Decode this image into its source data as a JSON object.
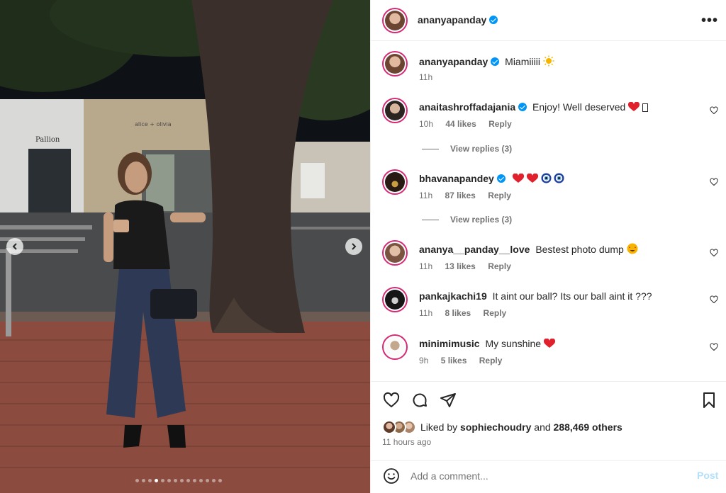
{
  "post": {
    "username": "ananyapanday",
    "caption": "Miamiiiii",
    "caption_time": "11h",
    "carousel": {
      "slides": 14,
      "active_index": 3
    }
  },
  "comments": [
    {
      "username": "anaitashroffadajania",
      "text": "Enjoy! Well deserved",
      "time": "10h",
      "likes": "44 likes",
      "reply": "Reply",
      "view_replies": "View replies (3)"
    },
    {
      "username": "bhavanapandey",
      "text": "",
      "time": "11h",
      "likes": "87 likes",
      "reply": "Reply",
      "view_replies": "View replies (3)"
    },
    {
      "username": "ananya__panday__love",
      "text": "Bestest photo dump",
      "time": "11h",
      "likes": "13 likes",
      "reply": "Reply"
    },
    {
      "username": "pankajkachi19",
      "text": "It aint our ball? Its our ball aint it ???",
      "time": "11h",
      "likes": "8 likes",
      "reply": "Reply"
    },
    {
      "username": "minimimusic",
      "text": "My sunshine",
      "time": "9h",
      "likes": "5 likes",
      "reply": "Reply"
    }
  ],
  "likes": {
    "prefix": "Liked by",
    "user": "sophiechoudry",
    "and": "and",
    "others": "288,469 others"
  },
  "timestamp": "11 hours ago",
  "composer": {
    "placeholder": "Add a comment...",
    "post_label": "Post"
  },
  "colors": {
    "verified": "#0095f6",
    "heart": "#ed1c24",
    "post_disabled": "#b2dffc",
    "story_ring": "#d62976"
  }
}
